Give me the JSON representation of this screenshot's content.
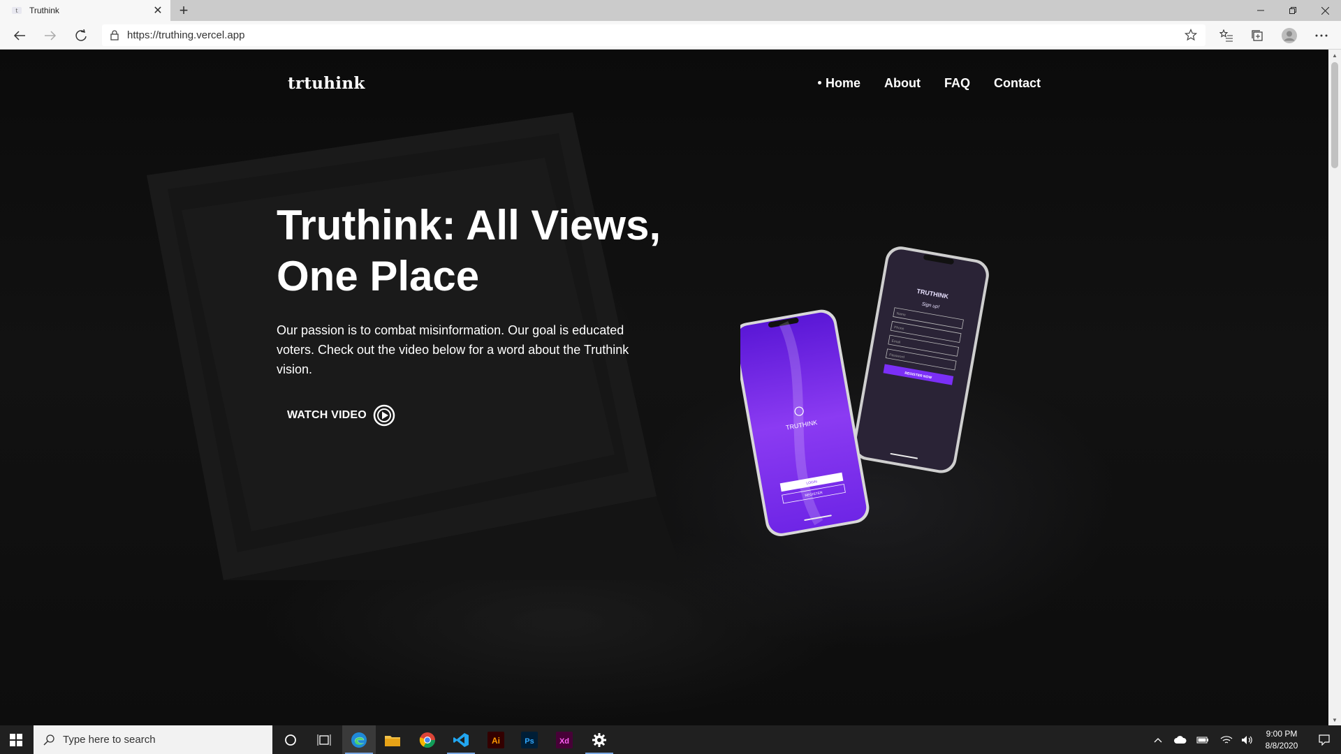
{
  "browser": {
    "tab_title": "Truthink",
    "url": "https://truthing.vercel.app"
  },
  "site": {
    "logo_text": "trtuhink",
    "nav": [
      {
        "label": "Home",
        "active": true
      },
      {
        "label": "About",
        "active": false
      },
      {
        "label": "FAQ",
        "active": false
      },
      {
        "label": "Contact",
        "active": false
      }
    ],
    "hero": {
      "title_line1": "Truthink: All Views,",
      "title_line2": "One Place",
      "paragraph": "Our passion is to combat misinformation. Our goal is educated voters. Check out the video below for a word about the Truthink vision.",
      "watch_label": "WATCH VIDEO"
    },
    "phone_mockup": {
      "brand": "TRUTHINK",
      "signup_title": "Sign up!",
      "fields": [
        "Name",
        "Phone",
        "Email",
        "Password"
      ],
      "register_now": "REGISTER NOW",
      "login": "LOGIN",
      "register": "REGISTER",
      "accent": "#7b2ff7"
    }
  },
  "taskbar": {
    "search_placeholder": "Type here to search",
    "time": "9:00 PM",
    "date": "8/8/2020"
  }
}
